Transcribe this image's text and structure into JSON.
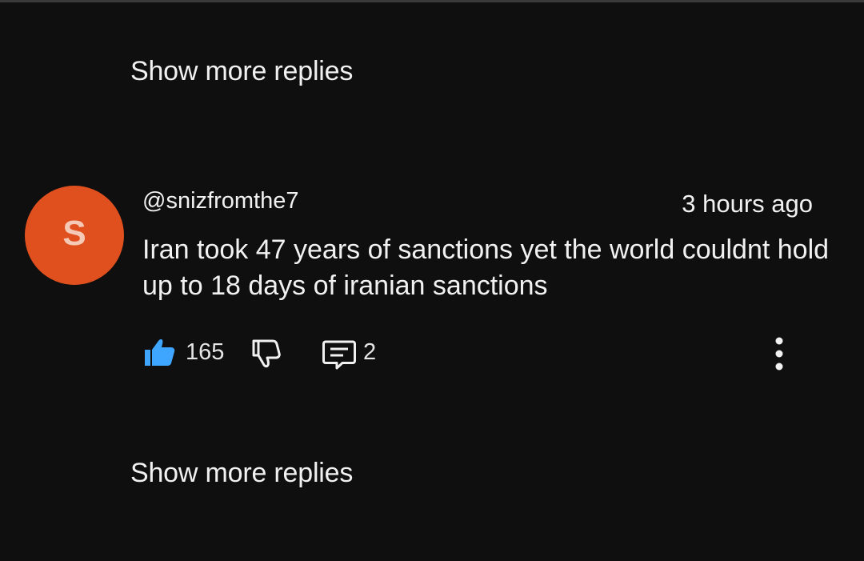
{
  "thread": {
    "show_more_top": "Show more replies",
    "show_more_bottom": "Show more replies"
  },
  "comment": {
    "avatar_letter": "S",
    "avatar_color": "#e0501f",
    "handle": "@snizfromthe7",
    "timestamp": "3 hours ago",
    "text": "Iran took 47 years of sanctions yet the world couldnt hold up to 18 days of iranian sanctions",
    "likes": "165",
    "replies": "2",
    "like_icon_color": "#3ea6ff",
    "icons": [
      "thumbs-up-icon",
      "thumbs-down-icon",
      "comment-reply-icon",
      "more-vertical-icon"
    ]
  }
}
